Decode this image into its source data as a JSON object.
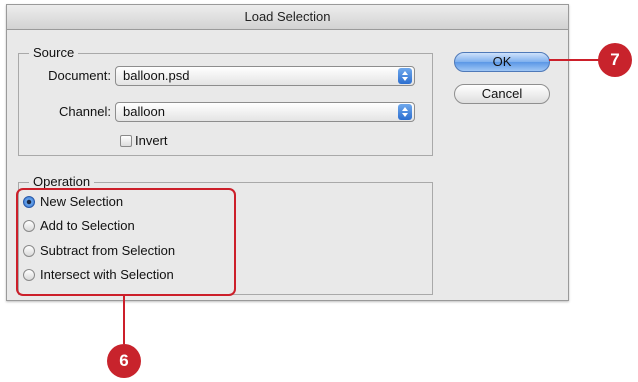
{
  "dialog": {
    "title": "Load Selection",
    "source": {
      "legend": "Source",
      "document_label": "Document:",
      "document_value": "balloon.psd",
      "channel_label": "Channel:",
      "channel_value": "balloon",
      "invert_label": "Invert",
      "invert_checked": false
    },
    "operation": {
      "legend": "Operation",
      "options": [
        {
          "label": "New Selection",
          "selected": true
        },
        {
          "label": "Add to Selection",
          "selected": false
        },
        {
          "label": "Subtract from Selection",
          "selected": false
        },
        {
          "label": "Intersect with Selection",
          "selected": false
        }
      ]
    },
    "buttons": {
      "ok_label": "OK",
      "cancel_label": "Cancel"
    }
  },
  "callouts": {
    "ok_callout": "7",
    "operation_callout": "6"
  },
  "colors": {
    "callout_red": "#c8232c",
    "accent_blue": "#5b97e6"
  }
}
